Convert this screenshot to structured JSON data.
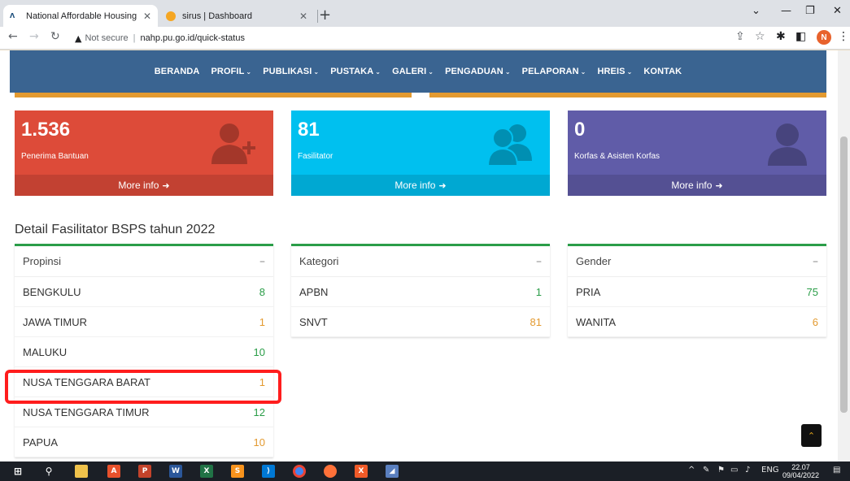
{
  "browser": {
    "tabs": [
      {
        "title": "National Affordable Housing Pro",
        "favicon": "nahp-logo"
      },
      {
        "title": "sirus | Dashboard",
        "favicon": "orange-dot"
      }
    ],
    "address": {
      "security_label": "Not secure",
      "url": "nahp.pu.go.id/quick-status"
    },
    "profile_initial": "N"
  },
  "nav": {
    "items": [
      {
        "label": "BERANDA",
        "dropdown": false
      },
      {
        "label": "PROFIL",
        "dropdown": true
      },
      {
        "label": "PUBLIKASI",
        "dropdown": true
      },
      {
        "label": "PUSTAKA",
        "dropdown": true
      },
      {
        "label": "GALERI",
        "dropdown": true
      },
      {
        "label": "PENGADUAN",
        "dropdown": true
      },
      {
        "label": "PELAPORAN",
        "dropdown": true
      },
      {
        "label": "HREIS",
        "dropdown": true
      },
      {
        "label": "KONTAK",
        "dropdown": false
      }
    ]
  },
  "stats": [
    {
      "value": "1.536",
      "label": "Penerima Bantuan",
      "more": "More info",
      "color": "#dd4b39"
    },
    {
      "value": "81",
      "label": "Fasilitator",
      "more": "More info",
      "color": "#00c0ef"
    },
    {
      "value": "0",
      "label": "Korfas & Asisten Korfas",
      "more": "More info",
      "color": "#605ca8"
    }
  ],
  "detail": {
    "title": "Detail Fasilitator BSPS tahun 2022",
    "propinsi": {
      "header": "Propinsi",
      "rows": [
        {
          "name": "BENGKULU",
          "count": "8"
        },
        {
          "name": "JAWA TIMUR",
          "count": "1"
        },
        {
          "name": "MALUKU",
          "count": "10"
        },
        {
          "name": "NUSA TENGGARA BARAT",
          "count": "1"
        },
        {
          "name": "NUSA TENGGARA TIMUR",
          "count": "12"
        },
        {
          "name": "PAPUA",
          "count": "10"
        }
      ]
    },
    "kategori": {
      "header": "Kategori",
      "rows": [
        {
          "name": "APBN",
          "count": "1"
        },
        {
          "name": "SNVT",
          "count": "81"
        }
      ]
    },
    "gender": {
      "header": "Gender",
      "rows": [
        {
          "name": "PRIA",
          "count": "75"
        },
        {
          "name": "WANITA",
          "count": "6"
        }
      ]
    }
  },
  "taskbar": {
    "tray_lang": "ENG",
    "time": "22.07",
    "date": "09/04/2022"
  }
}
